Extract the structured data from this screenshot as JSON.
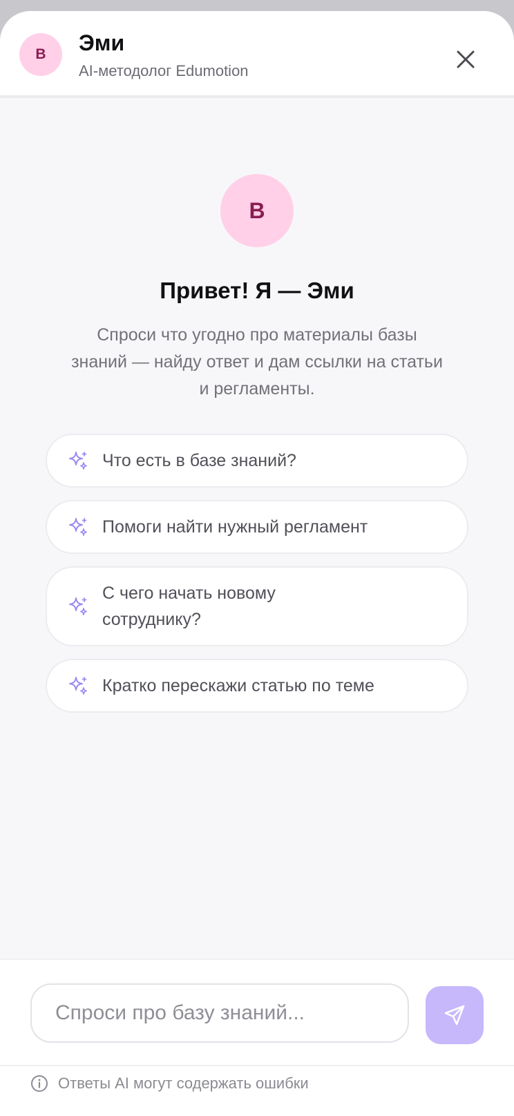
{
  "header": {
    "avatar_letter": "B",
    "title": "Эми",
    "subtitle": "AI-методолог Edumotion",
    "close_icon": "close-icon"
  },
  "welcome": {
    "avatar_letter": "B",
    "title": "Привет! Я — Эми",
    "text": "Спроси что угодно про материалы базы знаний — найду ответ и дам ссылки на статьи и регламенты."
  },
  "suggestions": [
    {
      "label": "Что есть в базе знаний?",
      "icon": "sparkles-icon"
    },
    {
      "label": "Помоги найти нужный регламент",
      "icon": "sparkles-icon"
    },
    {
      "label": "С чего начать новому сотруднику?",
      "icon": "sparkles-icon"
    },
    {
      "label": "Кратко перескажи статью по теме",
      "icon": "sparkles-icon"
    }
  ],
  "composer": {
    "placeholder": "Спроси про базу знаний...",
    "value": "",
    "send_icon": "send-icon"
  },
  "footer": {
    "disclaimer": "Ответы AI могут содержать ошибки",
    "info_icon": "info-icon"
  },
  "colors": {
    "accent": "#c6b8fb",
    "sparkle": "#9b8af0",
    "avatar_bg": "#ffd0e8",
    "avatar_fg": "#8a1d52",
    "background": "#f7f7f9"
  }
}
